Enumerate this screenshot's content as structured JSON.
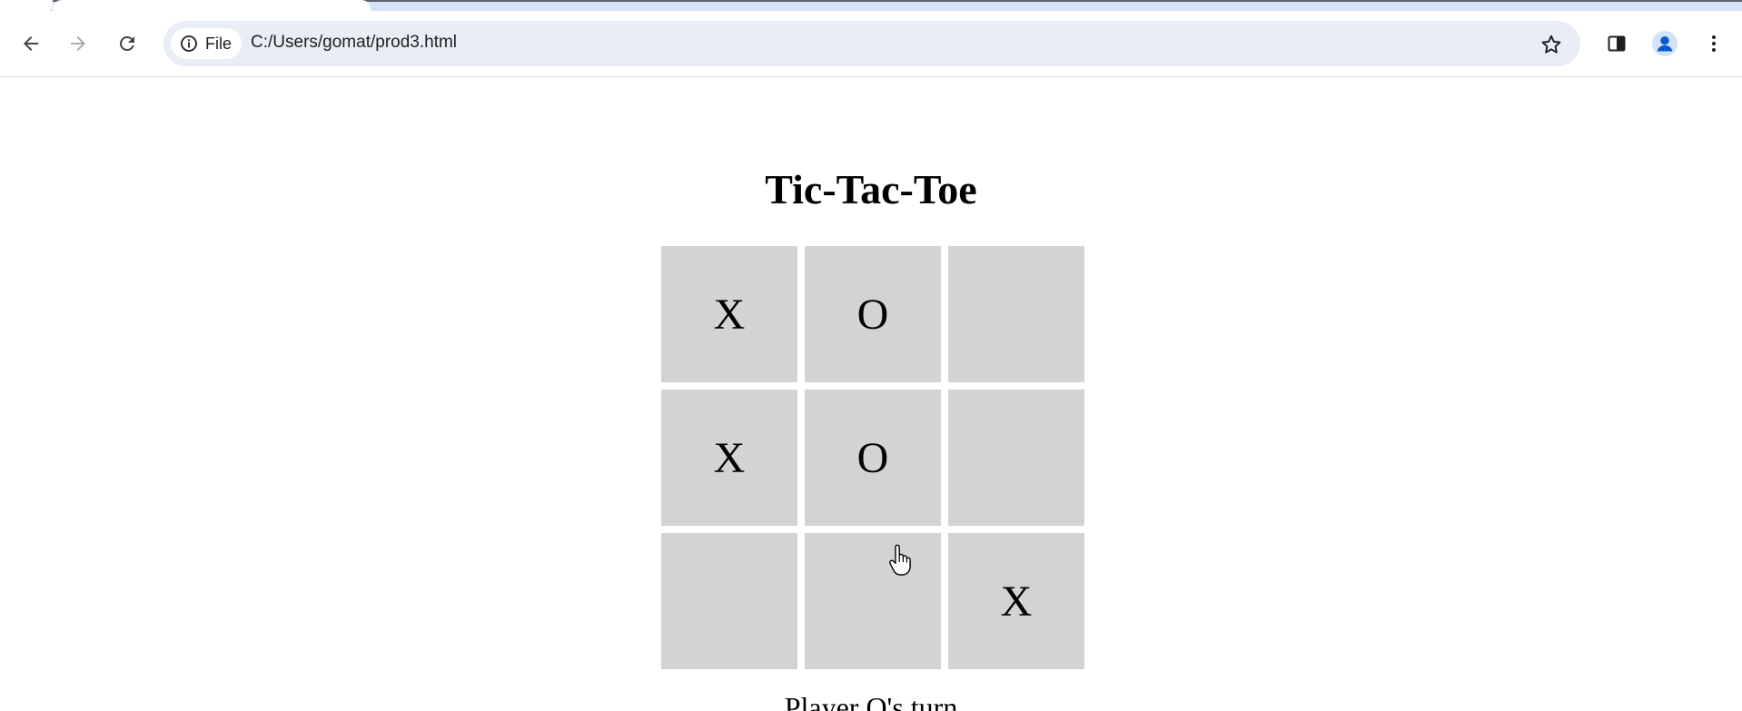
{
  "browser": {
    "site_chip_label": "File",
    "url": "C:/Users/gomat/prod3.html",
    "icons": {
      "back": "arrow-left-icon",
      "forward": "arrow-right-icon",
      "reload": "reload-icon",
      "info": "info-icon",
      "bookmark": "star-icon",
      "side_panel": "side-panel-icon",
      "profile": "profile-avatar-icon",
      "menu": "kebab-menu-icon"
    },
    "colors": {
      "tabstrip": "#d3e3fd",
      "omnibox": "#e9edf5",
      "profile_accent": "#0b57d0"
    }
  },
  "page": {
    "title": "Tic-Tac-Toe",
    "board": {
      "cells": [
        "X",
        "O",
        "",
        "X",
        "O",
        "",
        "",
        "",
        "X"
      ],
      "cell_color": "#d3d3d3"
    },
    "status": "Player O's turn"
  }
}
